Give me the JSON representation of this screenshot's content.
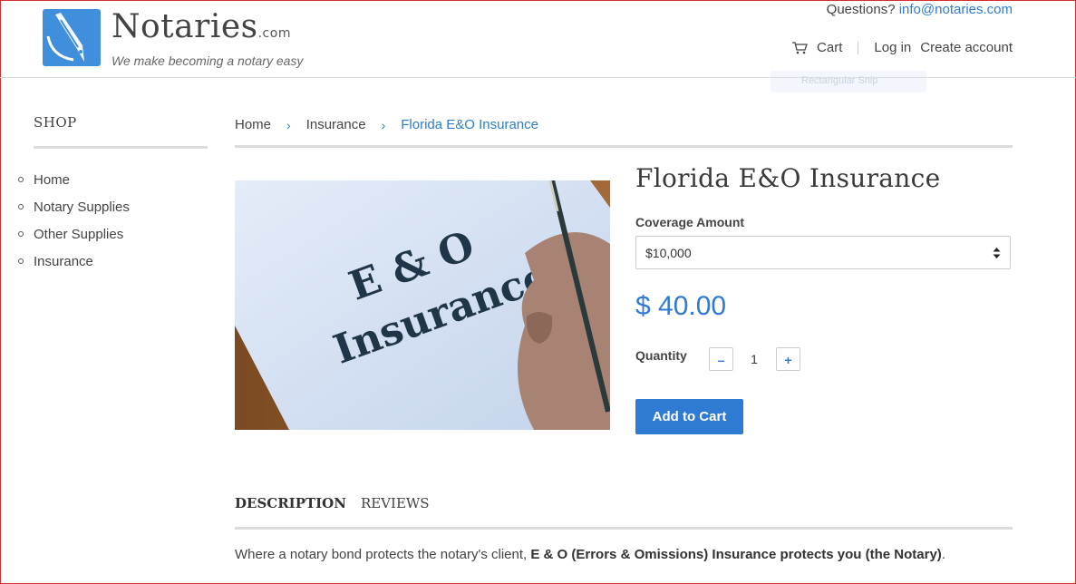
{
  "header": {
    "brand": {
      "name": "Notaries",
      "suffix": ".com",
      "tagline": "We make becoming a notary easy"
    },
    "questions_label": "Questions?",
    "email": "info@notaries.com",
    "nav": {
      "cart": "Cart",
      "login": "Log in",
      "create_account": "Create account"
    },
    "ghost_label": "Rectangular Snip"
  },
  "sidebar": {
    "title": "SHOP",
    "items": [
      {
        "label": "Home"
      },
      {
        "label": "Notary Supplies"
      },
      {
        "label": "Other Supplies"
      },
      {
        "label": "Insurance"
      }
    ]
  },
  "breadcrumb": {
    "items": [
      {
        "label": "Home"
      },
      {
        "label": "Insurance"
      },
      {
        "label": "Florida E&O Insurance"
      }
    ],
    "separator": "›"
  },
  "product": {
    "image": {
      "line1": "E & O",
      "line2": "Insurance"
    },
    "title": "Florida E&O Insurance",
    "coverage_label": "Coverage Amount",
    "coverage_selected": "$10,000",
    "price": "$ 40.00",
    "quantity_label": "Quantity",
    "quantity": "1",
    "minus": "–",
    "plus": "+",
    "add_to_cart": "Add to Cart"
  },
  "tabs": [
    {
      "label": "DESCRIPTION"
    },
    {
      "label": "REVIEWS"
    }
  ],
  "description": {
    "lead": "Where a notary bond protects the notary's client, ",
    "bold": "E & O (Errors & Omissions) Insurance protects you (the Notary)",
    "tail": "."
  },
  "colors": {
    "accent": "#2f7bd4",
    "logo": "#3f8fdd",
    "window_border": "#d32f2f"
  }
}
